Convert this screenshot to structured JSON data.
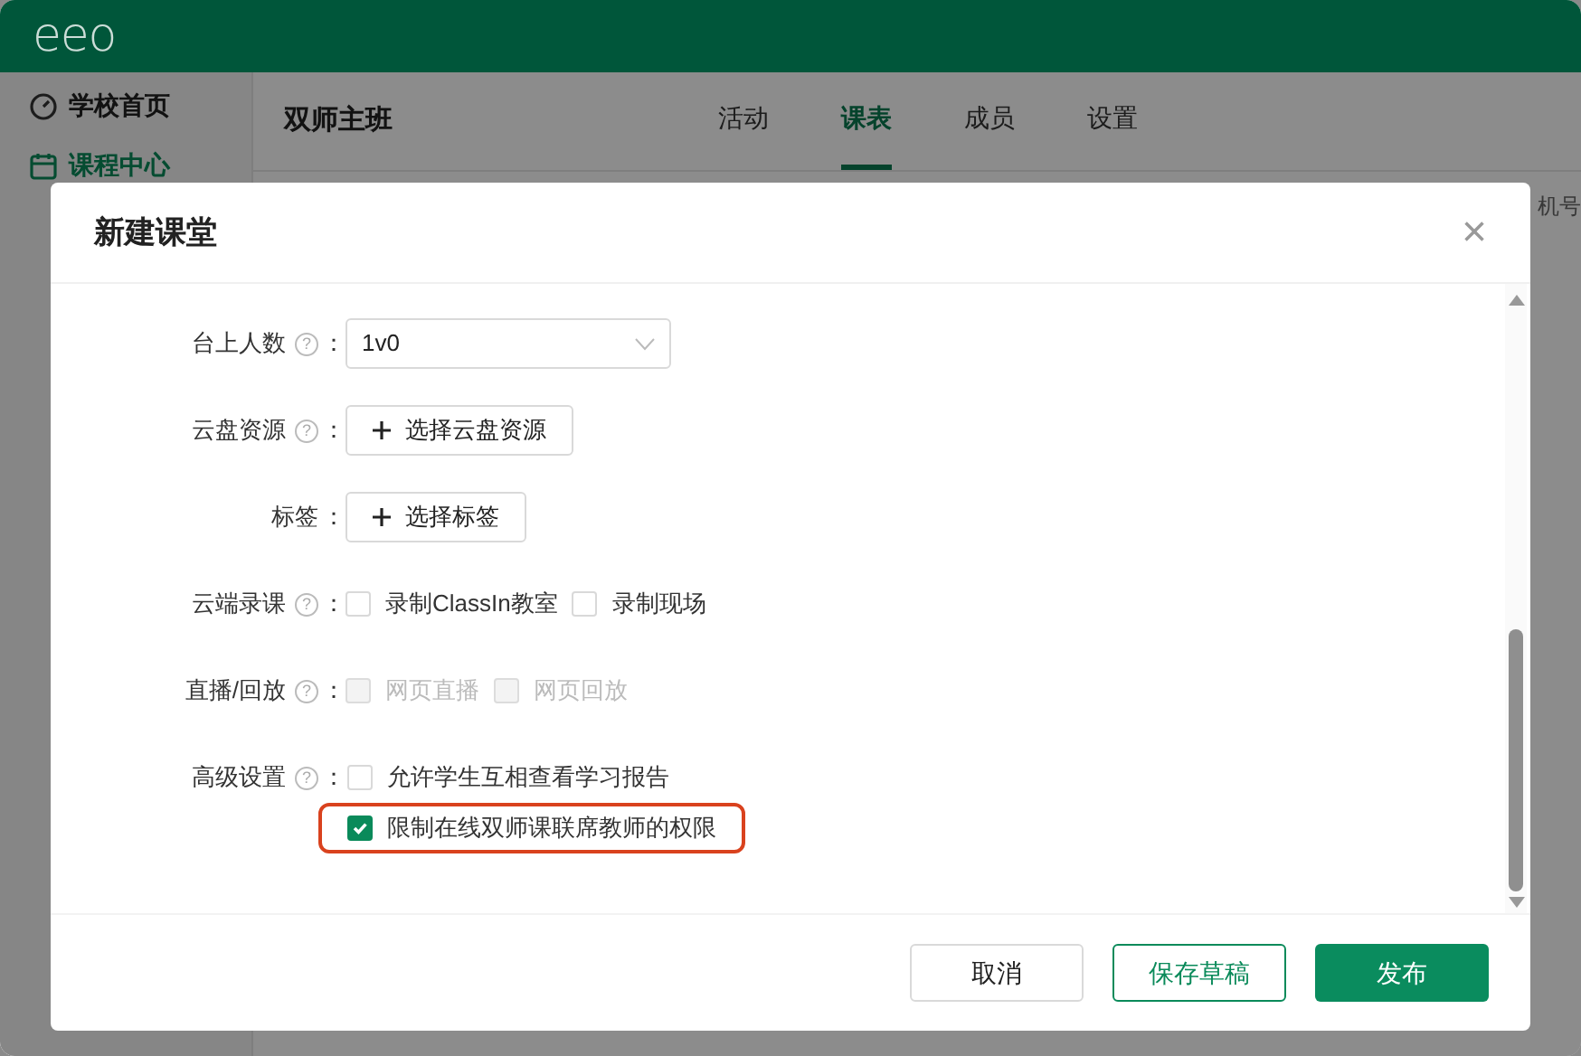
{
  "app": {
    "logo": "eeo",
    "sidebar": [
      {
        "label": "学校首页",
        "selected": false
      },
      {
        "label": "课程中心",
        "selected": true
      }
    ],
    "class_title": "双师主班",
    "tabs": [
      {
        "label": "活动",
        "selected": false
      },
      {
        "label": "课表",
        "selected": true
      },
      {
        "label": "成员",
        "selected": false
      },
      {
        "label": "设置",
        "selected": false
      }
    ],
    "column_text": "机号"
  },
  "dialog": {
    "title": "新建课堂",
    "close": "×",
    "fields": [
      {
        "label": "台上人数",
        "help": "?",
        "colon": "：",
        "kind": "select",
        "value": "1v0"
      },
      {
        "label": "云盘资源",
        "help": "?",
        "colon": "：",
        "kind": "button",
        "button": "选择云盘资源"
      },
      {
        "label": "标签",
        "colon": "：",
        "kind": "button",
        "button": "选择标签"
      },
      {
        "label": "云端录课",
        "help": "?",
        "colon": "：",
        "kind": "checkboxes",
        "options": [
          {
            "label": "录制ClassIn教室",
            "checked": false,
            "disabled": false
          },
          {
            "label": "录制现场",
            "checked": false,
            "disabled": false
          }
        ]
      },
      {
        "label": "直播/回放",
        "help": "?",
        "colon": "：",
        "kind": "checkboxes",
        "options": [
          {
            "label": "网页直播",
            "checked": false,
            "disabled": true
          },
          {
            "label": "网页回放",
            "checked": false,
            "disabled": true
          }
        ]
      },
      {
        "label": "高级设置",
        "help": "?",
        "colon": "：",
        "kind": "checklist",
        "options": [
          {
            "label": "允许学生互相查看学习报告",
            "checked": false,
            "highlighted": false
          },
          {
            "label": "限制在线双师课联席教师的权限",
            "checked": true,
            "highlighted": true
          }
        ]
      }
    ],
    "buttons": [
      {
        "label": "取消",
        "kind": "default"
      },
      {
        "label": "保存草稿",
        "kind": "outline"
      },
      {
        "label": "发布",
        "kind": "primary"
      }
    ]
  }
}
